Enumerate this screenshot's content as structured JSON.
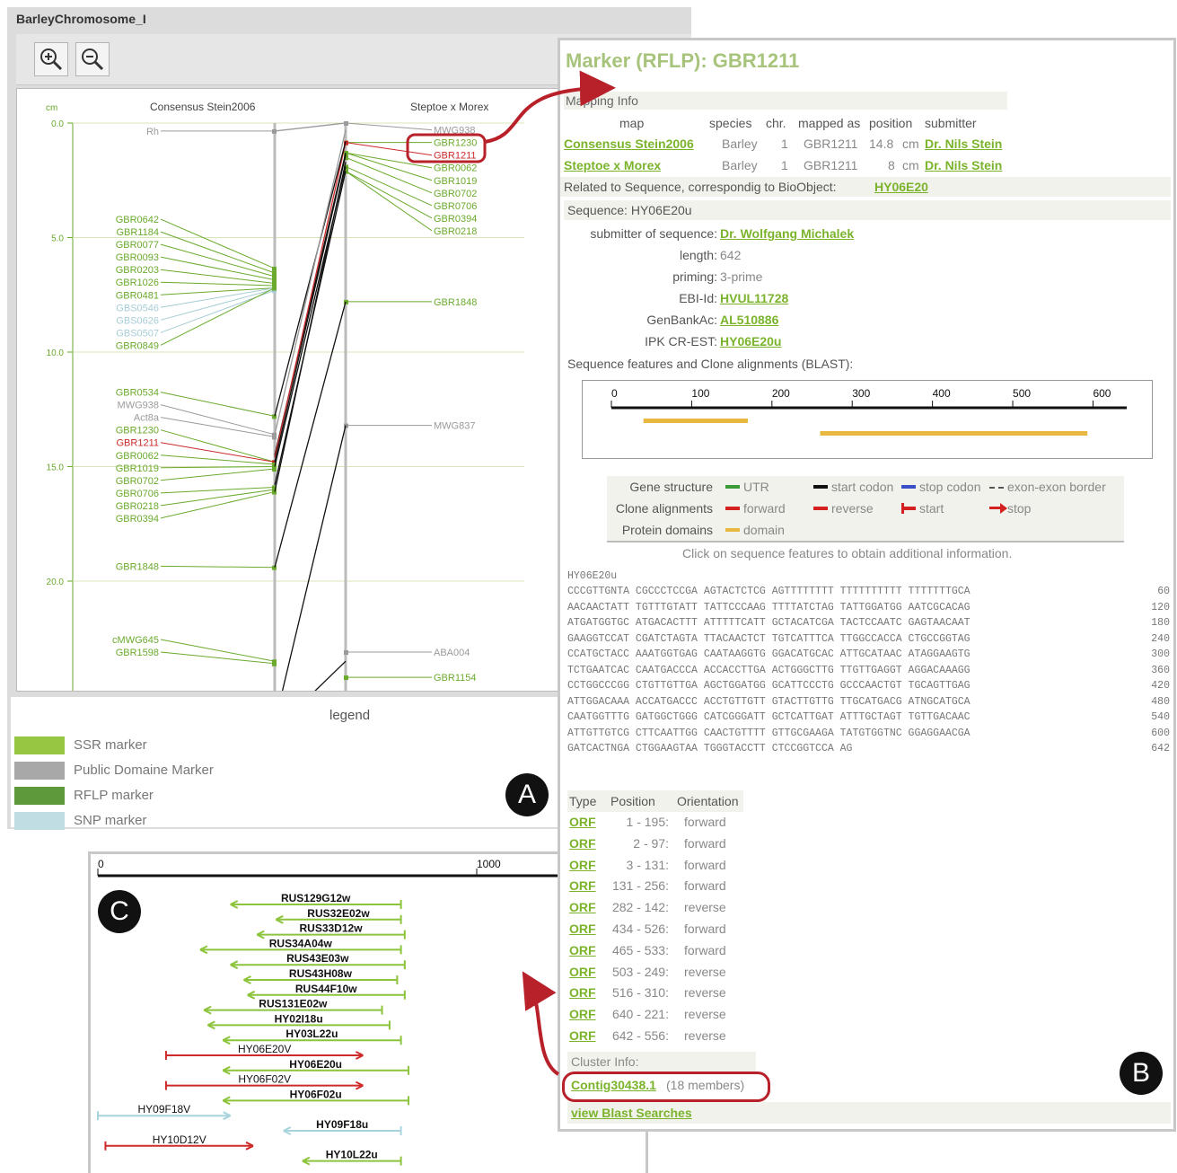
{
  "panel_a": {
    "title": "BarleyChromosome_I",
    "toolbar": {
      "zoom_in": "zoom-in-icon",
      "zoom_out": "zoom-out-icon"
    },
    "unit": "cm",
    "map_left_title": "Consensus Stein2006",
    "map_right_title": "Steptoe x Morex",
    "scale_ticks": [
      "0.0",
      "5.0",
      "10.0",
      "15.0",
      "20.0"
    ],
    "left_markers": [
      {
        "name": "Rh",
        "pos": 0.35,
        "kind": "public"
      },
      {
        "name": "GBR0642",
        "pos": 4.2,
        "kind": "ssr"
      },
      {
        "name": "GBR1184",
        "pos": 4.75,
        "kind": "ssr"
      },
      {
        "name": "GBR0077",
        "pos": 5.3,
        "kind": "ssr"
      },
      {
        "name": "GBR0093",
        "pos": 5.85,
        "kind": "ssr"
      },
      {
        "name": "GBR0203",
        "pos": 6.4,
        "kind": "ssr"
      },
      {
        "name": "GBR1026",
        "pos": 6.95,
        "kind": "ssr"
      },
      {
        "name": "GBR0481",
        "pos": 7.5,
        "kind": "ssr"
      },
      {
        "name": "GBS0546",
        "pos": 8.05,
        "kind": "snp"
      },
      {
        "name": "GBS0626",
        "pos": 8.6,
        "kind": "snp"
      },
      {
        "name": "GBS0507",
        "pos": 9.15,
        "kind": "snp"
      },
      {
        "name": "GBR0849",
        "pos": 9.7,
        "kind": "ssr"
      },
      {
        "name": "GBR0534",
        "pos": 11.75,
        "kind": "ssr"
      },
      {
        "name": "MWG938",
        "pos": 12.3,
        "kind": "public"
      },
      {
        "name": "Act8a",
        "pos": 12.85,
        "kind": "public"
      },
      {
        "name": "GBR1230",
        "pos": 13.4,
        "kind": "ssr"
      },
      {
        "name": "GBR1211",
        "pos": 13.95,
        "kind": "red"
      },
      {
        "name": "GBR0062",
        "pos": 14.5,
        "kind": "ssr"
      },
      {
        "name": "GBR1019",
        "pos": 15.05,
        "kind": "ssr"
      },
      {
        "name": "GBR0702",
        "pos": 15.6,
        "kind": "ssr"
      },
      {
        "name": "GBR0706",
        "pos": 16.15,
        "kind": "ssr"
      },
      {
        "name": "GBR0218",
        "pos": 16.7,
        "kind": "ssr"
      },
      {
        "name": "GBR0394",
        "pos": 17.25,
        "kind": "ssr"
      },
      {
        "name": "GBR1848",
        "pos": 19.35,
        "kind": "ssr"
      },
      {
        "name": "cMWG645",
        "pos": 22.55,
        "kind": "ssr"
      },
      {
        "name": "GBR1598",
        "pos": 23.1,
        "kind": "ssr"
      }
    ],
    "right_markers": [
      {
        "name": "MWG938",
        "pos": 0.3,
        "kind": "public"
      },
      {
        "name": "GBR1230",
        "pos": 0.85,
        "kind": "ssr"
      },
      {
        "name": "GBR1211",
        "pos": 1.4,
        "kind": "red"
      },
      {
        "name": "GBR0062",
        "pos": 1.95,
        "kind": "ssr"
      },
      {
        "name": "GBR1019",
        "pos": 2.5,
        "kind": "ssr"
      },
      {
        "name": "GBR0702",
        "pos": 3.05,
        "kind": "ssr"
      },
      {
        "name": "GBR0706",
        "pos": 3.6,
        "kind": "ssr"
      },
      {
        "name": "GBR0394",
        "pos": 4.15,
        "kind": "ssr"
      },
      {
        "name": "GBR0218",
        "pos": 4.7,
        "kind": "ssr"
      },
      {
        "name": "GBR1848",
        "pos": 7.8,
        "kind": "ssr"
      },
      {
        "name": "MWG837",
        "pos": 13.2,
        "kind": "public"
      },
      {
        "name": "ABA004",
        "pos": 23.1,
        "kind": "public"
      },
      {
        "name": "GBR1154",
        "pos": 24.2,
        "kind": "ssr"
      }
    ],
    "legend_title": "legend",
    "legend": [
      {
        "label": "SSR marker",
        "color": "#95c743"
      },
      {
        "label": "Public Domaine Marker",
        "color": "#a8a8a8"
      },
      {
        "label": "RFLP marker",
        "color": "#5c9a3c"
      },
      {
        "label": "SNP marker",
        "color": "#bfdde3"
      }
    ],
    "badge": "A"
  },
  "panel_b": {
    "title": "Marker (RFLP): GBR1211",
    "mapping_info_label": "Mapping Info",
    "mapping_headers": [
      "map",
      "species",
      "chr.",
      "mapped as",
      "position",
      "submitter"
    ],
    "mapping_rows": [
      {
        "map": "Consensus Stein2006",
        "species": "Barley",
        "chr": "1",
        "mapped_as": "GBR1211",
        "position": "14.8",
        "unit": "cm",
        "submitter": "Dr. Nils Stein"
      },
      {
        "map": "Steptoe x Morex",
        "species": "Barley",
        "chr": "1",
        "mapped_as": "GBR1211",
        "position": "8",
        "unit": "cm",
        "submitter": "Dr. Nils Stein"
      }
    ],
    "related_label": "Related to Sequence, correspondig to BioObject:",
    "related_link": "HY06E20",
    "sequence_label": "Sequence: HY06E20u",
    "details": [
      {
        "key": "submitter of sequence:",
        "value": "Dr. Wolfgang Michalek",
        "link": true
      },
      {
        "key": "length:",
        "value": "642",
        "link": false
      },
      {
        "key": "priming:",
        "value": "3-prime",
        "link": false
      },
      {
        "key": "EBI-Id:",
        "value": "HVUL11728",
        "link": true
      },
      {
        "key": "GenBankAc:",
        "value": "AL510886",
        "link": true
      },
      {
        "key": "IPK CR-EST:",
        "value": "HY06E20u",
        "link": true
      }
    ],
    "features_label": "Sequence features and Clone alignments (BLAST):",
    "feature_axis": [
      "0",
      "100",
      "200",
      "300",
      "400",
      "500",
      "600"
    ],
    "feature_bars": [
      {
        "start": 40,
        "end": 170
      },
      {
        "start": 260,
        "end": 593
      }
    ],
    "legend_rows": [
      {
        "label": "Gene structure",
        "items": [
          {
            "glyph": "solid",
            "color": "#3a9a3a",
            "text": "UTR"
          },
          {
            "glyph": "solid",
            "color": "#111111",
            "text": "start codon"
          },
          {
            "glyph": "solid",
            "color": "#3a50c8",
            "text": "stop codon"
          },
          {
            "glyph": "dash",
            "color": "#555555",
            "text": "exon-exon border"
          }
        ]
      },
      {
        "label": "Clone alignments",
        "items": [
          {
            "glyph": "solid",
            "color": "#d42020",
            "text": "forward"
          },
          {
            "glyph": "solid",
            "color": "#d42020",
            "text": "reverse"
          },
          {
            "glyph": "start",
            "color": "#d42020",
            "text": "start"
          },
          {
            "glyph": "arrow",
            "color": "#d42020",
            "text": "stop"
          }
        ]
      },
      {
        "label": "Protein domains",
        "items": [
          {
            "glyph": "solid",
            "color": "#e8b840",
            "text": "domain"
          }
        ]
      }
    ],
    "click_hint": "Click on sequence features to obtain additional information.",
    "seq_name": "HY06E20u",
    "seq_lines": [
      {
        "text": "CCCGTTGNTA CGCCCTCCGA AGTACTCTCG AGTTTTTTTT TTTTTTTTTT TTTTTTTGCA",
        "n": "60"
      },
      {
        "text": "AACAACTATT TGTTTGTATT TATTCCCAAG TTTTATCTAG TATTGGATGG AATCGCACAG",
        "n": "120"
      },
      {
        "text": "ATGATGGTGC ATGACACTTT ATTTTTCATT GCTACATCGA TACTCCAATC GAGTAACAAT",
        "n": "180"
      },
      {
        "text": "GAAGGTCCAT CGATCTAGTA TTACAACTCT TGTCATTTCA TTGGCCACCA CTGCCGGTAG",
        "n": "240"
      },
      {
        "text": "CCATGCTACC AAATGGTGAG CAATAAGGTG GGACATGCAC ATTGCATAAC ATAGGAAGTG",
        "n": "300"
      },
      {
        "text": "TCTGAATCAC CAATGACCCA ACCACCTTGA ACTGGGCTTG TTGTTGAGGT AGGACAAAGG",
        "n": "360"
      },
      {
        "text": "CCTGGCCCGG CTGTTGTTGA AGCTGGATGG GCATTCCCTG GCCCAACTGT TGCAGTTGAG",
        "n": "420"
      },
      {
        "text": "ATTGGACAAA ACCATGACCC ACCTGTTGTT GTACTTGTTG TTGCATGACG ATNGCATGCA",
        "n": "480"
      },
      {
        "text": "CAATGGTTTG GATGGCTGGG CATCGGGATT GCTCATTGAT ATTTGCTAGT TGTTGACAAC",
        "n": "540"
      },
      {
        "text": "ATTGTTGTCG CTTCAATTGG CAACTGTTTT GTTGCGAAGA TATGTGGTNC GGAGGAACGA",
        "n": "600"
      },
      {
        "text": "GATCACTNGA CTGGAAGTAA TGGGTACCTT CTCCGGTCCA AG",
        "n": "642"
      }
    ],
    "orf_headers": [
      "Type",
      "Position",
      "Orientation"
    ],
    "orfs": [
      {
        "type": "ORF",
        "pos": "1 - 195:",
        "orient": "forward"
      },
      {
        "type": "ORF",
        "pos": "2 - 97:",
        "orient": "forward"
      },
      {
        "type": "ORF",
        "pos": "3 - 131:",
        "orient": "forward"
      },
      {
        "type": "ORF",
        "pos": "131 - 256:",
        "orient": "forward"
      },
      {
        "type": "ORF",
        "pos": "282 - 142:",
        "orient": "reverse"
      },
      {
        "type": "ORF",
        "pos": "434 - 526:",
        "orient": "forward"
      },
      {
        "type": "ORF",
        "pos": "465 - 533:",
        "orient": "forward"
      },
      {
        "type": "ORF",
        "pos": "503 - 249:",
        "orient": "reverse"
      },
      {
        "type": "ORF",
        "pos": "516 - 310:",
        "orient": "reverse"
      },
      {
        "type": "ORF",
        "pos": "640 - 221:",
        "orient": "reverse"
      },
      {
        "type": "ORF",
        "pos": "642 - 556:",
        "orient": "reverse"
      }
    ],
    "cluster_label": "Cluster Info:",
    "cluster_link": "Contig30438.1",
    "cluster_members": "(18 members)",
    "blast_link": "view Blast Searches",
    "badge": "B"
  },
  "panel_c": {
    "axis_labels": [
      "0",
      "1000"
    ],
    "rows": [
      {
        "label": "RUS129G12w",
        "start": 350,
        "end": 800,
        "color": "#8cc43c",
        "bold": true,
        "dir": "left"
      },
      {
        "label": "RUS32E02w",
        "start": 470,
        "end": 800,
        "color": "#8cc43c",
        "bold": true,
        "dir": "left"
      },
      {
        "label": "RUS33D12w",
        "start": 420,
        "end": 810,
        "color": "#8cc43c",
        "bold": true,
        "dir": "left"
      },
      {
        "label": "RUS34A04w",
        "start": 270,
        "end": 800,
        "color": "#8cc43c",
        "bold": true,
        "dir": "left"
      },
      {
        "label": "RUS43E03w",
        "start": 350,
        "end": 810,
        "color": "#8cc43c",
        "bold": true,
        "dir": "left"
      },
      {
        "label": "RUS43H08w",
        "start": 385,
        "end": 790,
        "color": "#8cc43c",
        "bold": true,
        "dir": "left"
      },
      {
        "label": "RUS44F10w",
        "start": 395,
        "end": 810,
        "color": "#8cc43c",
        "bold": true,
        "dir": "left"
      },
      {
        "label": "RUS131E02w",
        "start": 280,
        "end": 750,
        "color": "#8cc43c",
        "bold": true,
        "dir": "left"
      },
      {
        "label": "HY02I18u",
        "start": 290,
        "end": 770,
        "color": "#8cc43c",
        "bold": true,
        "dir": "left"
      },
      {
        "label": "HY03L22u",
        "start": 330,
        "end": 800,
        "color": "#8cc43c",
        "bold": true,
        "dir": "left"
      },
      {
        "label": "HY06E20V",
        "start": 180,
        "end": 700,
        "color": "#cf2a2a",
        "bold": false,
        "dir": "right"
      },
      {
        "label": "HY06E20u",
        "start": 330,
        "end": 820,
        "color": "#8cc43c",
        "bold": true,
        "dir": "left"
      },
      {
        "label": "HY06F02V",
        "start": 180,
        "end": 700,
        "color": "#cf2a2a",
        "bold": false,
        "dir": "right"
      },
      {
        "label": "HY06F02u",
        "start": 330,
        "end": 820,
        "color": "#8cc43c",
        "bold": true,
        "dir": "left"
      },
      {
        "label": "HY09F18V",
        "start": 0,
        "end": 350,
        "color": "#a8d4de",
        "bold": false,
        "dir": "right"
      },
      {
        "label": "HY09F18u",
        "start": 490,
        "end": 800,
        "color": "#a8d4de",
        "bold": true,
        "dir": "left"
      },
      {
        "label": "HY10D12V",
        "start": 20,
        "end": 410,
        "color": "#cf2a2a",
        "bold": false,
        "dir": "right"
      },
      {
        "label": "HY10L22u",
        "start": 540,
        "end": 800,
        "color": "#8cc43c",
        "bold": true,
        "dir": "left"
      }
    ],
    "badge": "C"
  }
}
